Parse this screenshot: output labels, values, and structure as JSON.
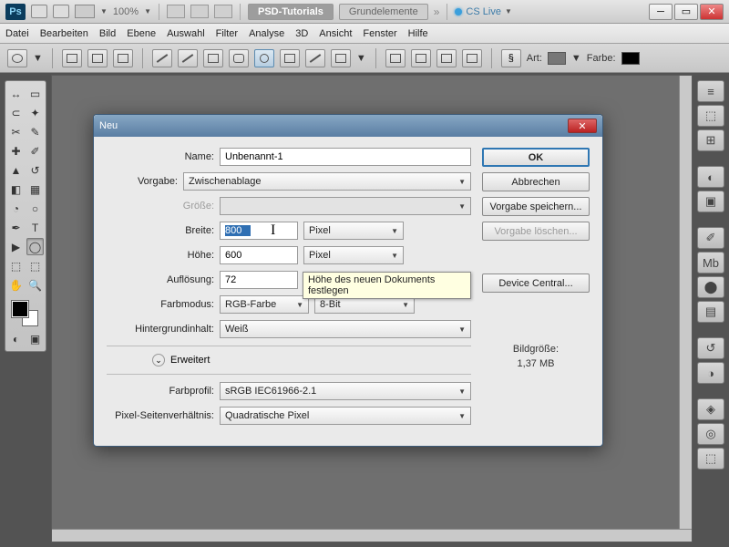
{
  "appbar": {
    "zoom": "100%",
    "tab_active": "PSD-Tutorials",
    "tab_inactive": "Grundelemente",
    "cslive": "CS Live"
  },
  "menubar": [
    "Datei",
    "Bearbeiten",
    "Bild",
    "Ebene",
    "Auswahl",
    "Filter",
    "Analyse",
    "3D",
    "Ansicht",
    "Fenster",
    "Hilfe"
  ],
  "optbar": {
    "art": "Art:",
    "farbe": "Farbe:"
  },
  "dialog": {
    "title": "Neu",
    "name_label": "Name:",
    "name_value": "Unbenannt-1",
    "preset_label": "Vorgabe:",
    "preset_value": "Zwischenablage",
    "size_label": "Größe:",
    "width_label": "Breite:",
    "width_value": "800",
    "width_unit": "Pixel",
    "height_label": "Höhe:",
    "height_value": "600",
    "height_unit": "Pixel",
    "res_label": "Auflösung:",
    "res_value": "72",
    "mode_label": "Farbmodus:",
    "mode_value": "RGB-Farbe",
    "mode_bits": "8-Bit",
    "bg_label": "Hintergrundinhalt:",
    "bg_value": "Weiß",
    "advanced": "Erweitert",
    "profile_label": "Farbprofil:",
    "profile_value": "sRGB IEC61966-2.1",
    "par_label": "Pixel-Seitenverhältnis:",
    "par_value": "Quadratische Pixel",
    "ok": "OK",
    "cancel": "Abbrechen",
    "save_preset": "Vorgabe speichern...",
    "delete_preset": "Vorgabe löschen...",
    "device_central": "Device Central...",
    "filesize_label": "Bildgröße:",
    "filesize_value": "1,37 MB",
    "tooltip": "Höhe des neuen Dokuments festlegen"
  }
}
